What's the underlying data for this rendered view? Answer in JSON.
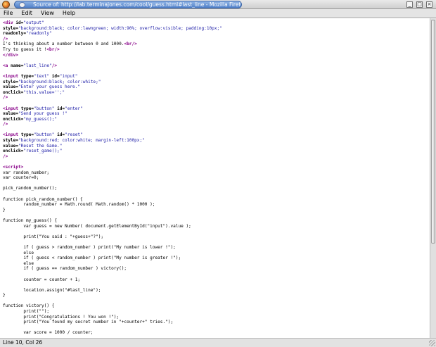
{
  "window": {
    "title": "Source of: http://lab.terminajones.com/cool/guess.html#last_line - Mozilla Firefox",
    "buttons": [
      "_",
      "□",
      "×"
    ]
  },
  "menu": [
    "File",
    "Edit",
    "View",
    "Help"
  ],
  "source_lines": [
    [
      [
        "t",
        "<div "
      ],
      [
        "a",
        "id="
      ],
      [
        "v",
        "\"output\""
      ]
    ],
    [
      [
        "a",
        "style="
      ],
      [
        "v",
        "\"background:black; color:lawngreen; width:90%; overflow:visible; padding:10px;\""
      ]
    ],
    [
      [
        "a",
        "readonly="
      ],
      [
        "v",
        "\"readonly\""
      ]
    ],
    [
      [
        "t",
        "/>"
      ]
    ],
    [
      [
        "p",
        "I's thinking about a number between 0 and 1000."
      ],
      [
        "t",
        "<br/>"
      ]
    ],
    [
      [
        "p",
        "Try to guess it !"
      ],
      [
        "t",
        "<br/>"
      ]
    ],
    [
      [
        "t",
        "</div>"
      ]
    ],
    [
      [
        "p",
        ""
      ]
    ],
    [
      [
        "t",
        "<a "
      ],
      [
        "a",
        "name="
      ],
      [
        "v",
        "\"last_line\""
      ],
      [
        "t",
        "/>"
      ]
    ],
    [
      [
        "p",
        ""
      ]
    ],
    [
      [
        "t",
        "<input "
      ],
      [
        "a",
        "type="
      ],
      [
        "v",
        "\"text\" "
      ],
      [
        "a",
        "id="
      ],
      [
        "v",
        "\"input\""
      ]
    ],
    [
      [
        "a",
        "style="
      ],
      [
        "v",
        "\"background:black; color:white;\""
      ]
    ],
    [
      [
        "a",
        "value="
      ],
      [
        "v",
        "\"Enter your guess here.\""
      ]
    ],
    [
      [
        "a",
        "onclick="
      ],
      [
        "v",
        "\"this.value='';\""
      ]
    ],
    [
      [
        "t",
        "/>"
      ]
    ],
    [
      [
        "p",
        ""
      ]
    ],
    [
      [
        "t",
        "<input "
      ],
      [
        "a",
        "type="
      ],
      [
        "v",
        "\"button\" "
      ],
      [
        "a",
        "id="
      ],
      [
        "v",
        "\"enter\""
      ]
    ],
    [
      [
        "a",
        "value="
      ],
      [
        "v",
        "\"Send your guess !\""
      ]
    ],
    [
      [
        "a",
        "onclick="
      ],
      [
        "v",
        "\"my_guess();\""
      ]
    ],
    [
      [
        "t",
        "/>"
      ]
    ],
    [
      [
        "p",
        ""
      ]
    ],
    [
      [
        "t",
        "<input "
      ],
      [
        "a",
        "type="
      ],
      [
        "v",
        "\"button\" "
      ],
      [
        "a",
        "id="
      ],
      [
        "v",
        "\"reset\""
      ]
    ],
    [
      [
        "a",
        "style="
      ],
      [
        "v",
        "\"background:red; color:white; margin-left:100px;\""
      ]
    ],
    [
      [
        "a",
        "value="
      ],
      [
        "v",
        "\"Reset the Game.\""
      ]
    ],
    [
      [
        "a",
        "onclick="
      ],
      [
        "v",
        "\"reset_game();\""
      ]
    ],
    [
      [
        "t",
        "/>"
      ]
    ],
    [
      [
        "p",
        ""
      ]
    ],
    [
      [
        "t",
        "<script>"
      ]
    ],
    [
      [
        "p",
        "var random_number;"
      ]
    ],
    [
      [
        "p",
        "var counter=0;"
      ]
    ],
    [
      [
        "p",
        ""
      ]
    ],
    [
      [
        "p",
        "pick_random_number();"
      ]
    ],
    [
      [
        "p",
        ""
      ]
    ],
    [
      [
        "p",
        "function pick_random_number() {"
      ]
    ],
    [
      [
        "p",
        "        random_number = Math.round( Math.random() * 1000 );"
      ]
    ],
    [
      [
        "p",
        "}"
      ]
    ],
    [
      [
        "p",
        ""
      ]
    ],
    [
      [
        "p",
        "function my_guess() {"
      ]
    ],
    [
      [
        "p",
        "        var guess = new Number( document.getElementById(\"input\").value );"
      ]
    ],
    [
      [
        "p",
        ""
      ]
    ],
    [
      [
        "p",
        "        print(\"You said : \"+guess+\"?\");"
      ]
    ],
    [
      [
        "p",
        ""
      ]
    ],
    [
      [
        "p",
        "        if ( guess > random_number ) print(\"My number is lower !\");"
      ]
    ],
    [
      [
        "p",
        "        else"
      ]
    ],
    [
      [
        "p",
        "        if ( guess < random_number ) print(\"My number is greater !\");"
      ]
    ],
    [
      [
        "p",
        "        else"
      ]
    ],
    [
      [
        "p",
        "        if ( guess == random_number ) victory();"
      ]
    ],
    [
      [
        "p",
        ""
      ]
    ],
    [
      [
        "p",
        "        counter = counter + 1;"
      ]
    ],
    [
      [
        "p",
        ""
      ]
    ],
    [
      [
        "p",
        "        location.assign(\"#last_line\");"
      ]
    ],
    [
      [
        "p",
        "}"
      ]
    ],
    [
      [
        "p",
        ""
      ]
    ],
    [
      [
        "p",
        "function victory() {"
      ]
    ],
    [
      [
        "p",
        "        print(\"\");"
      ]
    ],
    [
      [
        "p",
        "        print(\"Congratulations ! You won !\");"
      ]
    ],
    [
      [
        "p",
        "        print(\"You found my secret number in \"+counter+\" tries.\");"
      ]
    ],
    [
      [
        "p",
        ""
      ]
    ],
    [
      [
        "p",
        "        var score = 1000 / counter;"
      ]
    ]
  ],
  "status": {
    "position": "Line 10, Col 26"
  }
}
